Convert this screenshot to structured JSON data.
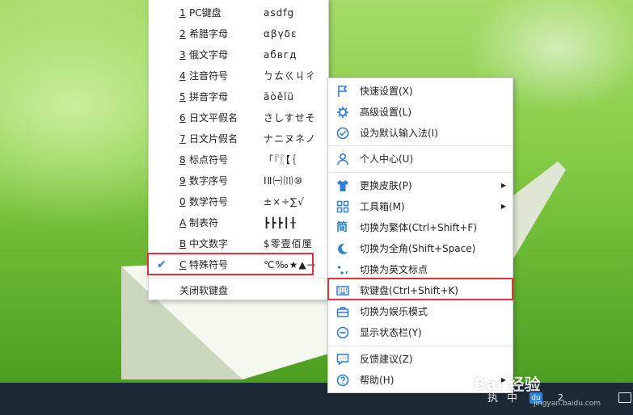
{
  "softkeyboard_menu": {
    "items": [
      {
        "key": "1",
        "label": "PC键盘",
        "symbols": "asdfg"
      },
      {
        "key": "2",
        "label": "希腊字母",
        "symbols": "αβγδε"
      },
      {
        "key": "3",
        "label": "俄文字母",
        "symbols": "абвгд"
      },
      {
        "key": "4",
        "label": "注音符号",
        "symbols": "ㄅㄊㄍㄐㄔ"
      },
      {
        "key": "5",
        "label": "拼音字母",
        "symbols": "āòěǐü"
      },
      {
        "key": "6",
        "label": "日文平假名",
        "symbols": "さしすせそ"
      },
      {
        "key": "7",
        "label": "日文片假名",
        "symbols": "ナニヌネノ"
      },
      {
        "key": "8",
        "label": "标点符号",
        "symbols": "「『〖【｛"
      },
      {
        "key": "9",
        "label": "数字序号",
        "symbols": "ⅠⅡ㈠⑾⑩"
      },
      {
        "key": "0",
        "label": "数学符号",
        "symbols": "±×÷∑√"
      },
      {
        "key": "A",
        "label": "制表符",
        "symbols": "┣┣┣┃╂"
      },
      {
        "key": "B",
        "label": "中文数字",
        "symbols": "$零壹佰厘"
      },
      {
        "key": "C",
        "label": "特殊符号",
        "symbols": "℃‰★▲→"
      }
    ],
    "close_label": "关闭软键盘"
  },
  "ime_menu": {
    "items": [
      {
        "icon": "flag-icon",
        "label": "快速设置(X)"
      },
      {
        "icon": "gear-icon",
        "label": "高级设置(L)"
      },
      {
        "icon": "check-circle-icon",
        "label": "设为默认输入法(I)"
      },
      {
        "icon": "user-icon",
        "label": "个人中心(U)"
      },
      {
        "icon": "shirt-icon",
        "label": "更换皮肤(P)"
      },
      {
        "icon": "grid-icon",
        "label": "工具箱(M)"
      },
      {
        "icon": "traditional-char-icon",
        "label": "切换为繁体(Ctrl+Shift+F)"
      },
      {
        "icon": "moon-icon",
        "label": "切换为全角(Shift+Space)"
      },
      {
        "icon": "punctuation-icon",
        "label": "切换为英文标点"
      },
      {
        "icon": "keyboard-icon",
        "label": "软键盘(Ctrl+Shift+K)"
      },
      {
        "icon": "briefcase-icon",
        "label": "切换为娱乐模式"
      },
      {
        "icon": "minus-circle-icon",
        "label": "显示状态栏(Y)"
      },
      {
        "icon": "chat-icon",
        "label": "反馈建议(Z)"
      },
      {
        "icon": "help-icon",
        "label": "帮助(H)"
      }
    ],
    "traditional_glyph": "简"
  },
  "taskbar": {
    "ch1": "执",
    "ch2": "中",
    "ime_badge": "du",
    "num": "2"
  },
  "watermark": {
    "text": "Bai 经验",
    "sub": "jingyan.baidu.com"
  },
  "colors": {
    "accent": "#2f7fd4",
    "highlight": "#e0303a"
  }
}
